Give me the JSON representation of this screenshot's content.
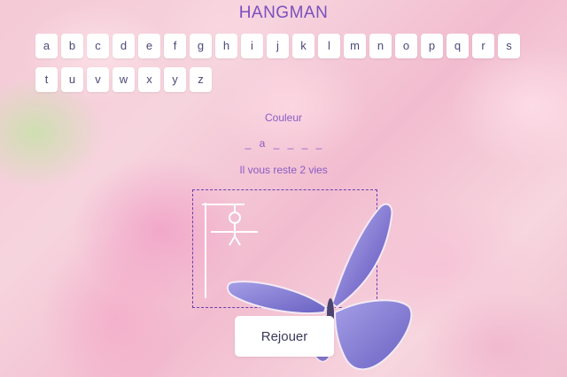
{
  "title": "HANGMAN",
  "letters": [
    "a",
    "b",
    "c",
    "d",
    "e",
    "f",
    "g",
    "h",
    "i",
    "j",
    "k",
    "l",
    "m",
    "n",
    "o",
    "p",
    "q",
    "r",
    "s",
    "t",
    "u",
    "v",
    "w",
    "x",
    "y",
    "z"
  ],
  "category": "Couleur",
  "word_display": [
    "_",
    "a",
    "_",
    "_",
    "_",
    "_"
  ],
  "lives_text": "Il vous reste 2 vies",
  "replay_label": "Rejouer",
  "colors": {
    "title": "#7b4fbd",
    "text": "#8a5cc4",
    "gallows_border": "#6a3fb0",
    "butterfly": "#8e86d6"
  }
}
